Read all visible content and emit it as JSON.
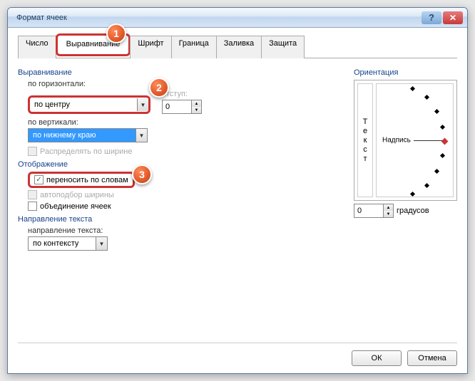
{
  "title": "Формат ячеек",
  "tabs": [
    "Число",
    "Выравнивание",
    "Шрифт",
    "Граница",
    "Заливка",
    "Защита"
  ],
  "activeTab": 1,
  "align": {
    "group": "Выравнивание",
    "horizLabel": "по горизонтали:",
    "horizValue": "по центру",
    "indentLabel": "отступ:",
    "indentValue": "0",
    "vertLabel": "по вертикали:",
    "vertValue": "по нижнему краю",
    "distribute": "Распределять по ширине"
  },
  "display": {
    "group": "Отображение",
    "wrap": "переносить по словам",
    "autofit": "автоподбор ширины",
    "merge": "объединение ячеек"
  },
  "textdir": {
    "group": "Направление текста",
    "label": "направление текста:",
    "value": "по контексту"
  },
  "orient": {
    "group": "Ориентация",
    "vtext": "Текст",
    "caption": "Надпись",
    "degValue": "0",
    "degLabel": "градусов"
  },
  "buttons": {
    "ok": "ОК",
    "cancel": "Отмена"
  },
  "markers": {
    "m1": "1",
    "m2": "2",
    "m3": "3"
  }
}
